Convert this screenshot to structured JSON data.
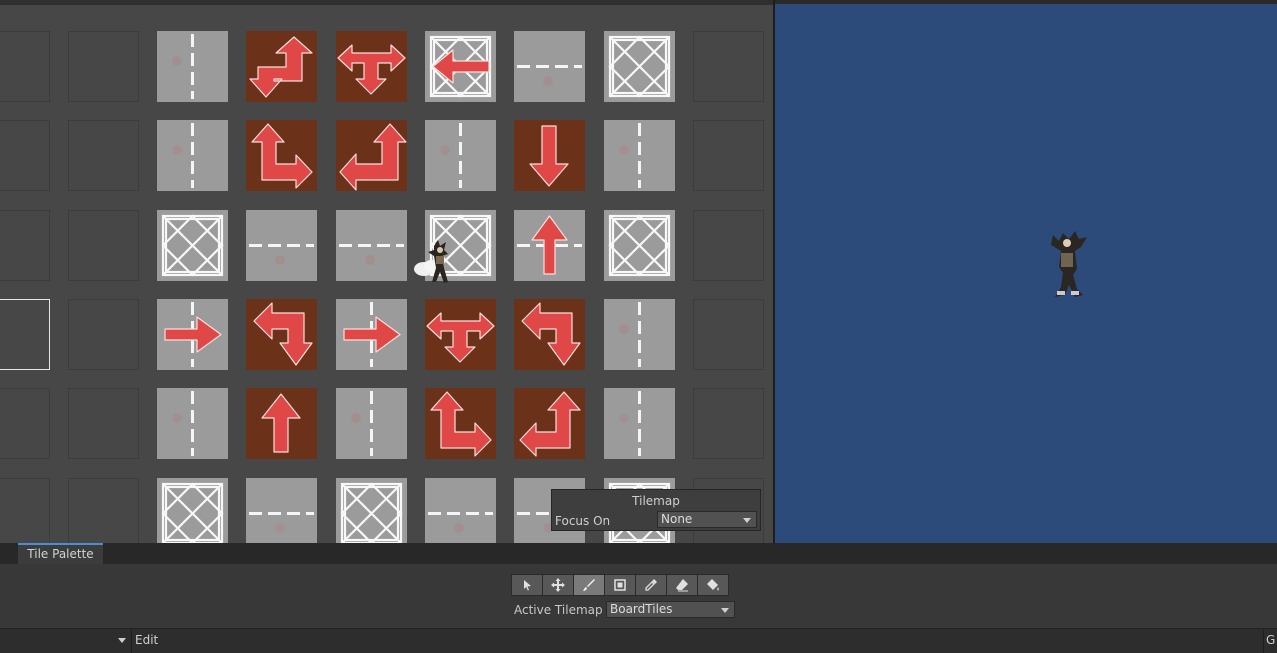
{
  "overlay": {
    "title": "Tilemap",
    "focus_label": "Focus On",
    "focus_value": "None"
  },
  "palette": {
    "tab_label": "Tile Palette",
    "tools": [
      "select-icon",
      "move-icon",
      "paint-brush-icon",
      "box-fill-icon",
      "picker-icon",
      "eraser-icon",
      "flood-fill-icon"
    ],
    "active_tool": "paint-brush-icon",
    "active_tilemap_label": "Active Tilemap",
    "active_tilemap_value": "BoardTiles"
  },
  "bottom_bar": {
    "edit_label": "Edit",
    "right_label": "G"
  },
  "tiles": [
    [
      "road-vertical",
      "arrow-turn-up-right-down",
      "arrow-t-left-right-down",
      "arrow-left-over-cross",
      "road-horizontal",
      "crossing"
    ],
    [
      "road-vertical",
      "arrow-up-turn-right",
      "arrow-right-down-turn-left",
      "road-vertical",
      "arrow-down",
      "road-vertical"
    ],
    [
      "crossing",
      "road-horizontal",
      "road-horizontal",
      "crossing",
      "arrow-up-on-road",
      "crossing"
    ],
    [
      "arrow-right-on-road",
      "arrow-left-turn-down",
      "arrow-right-on-road",
      "arrow-t-left-right-down",
      "arrow-left-turn-down",
      "road-vertical"
    ],
    [
      "road-vertical",
      "arrow-up",
      "road-vertical",
      "arrow-up-turn-right",
      "arrow-up-turn-left",
      "road-vertical"
    ],
    [
      "crossing",
      "road-horizontal",
      "crossing",
      "road-horizontal",
      "road-horizontal",
      "crossing"
    ]
  ],
  "colors": {
    "scene_bg": "#474747",
    "game_bg": "#2c4a7a",
    "arrow_red": "#e04848",
    "arrow_tile_bg": "#6b3219",
    "road_tile_bg": "#9b9b9b"
  }
}
